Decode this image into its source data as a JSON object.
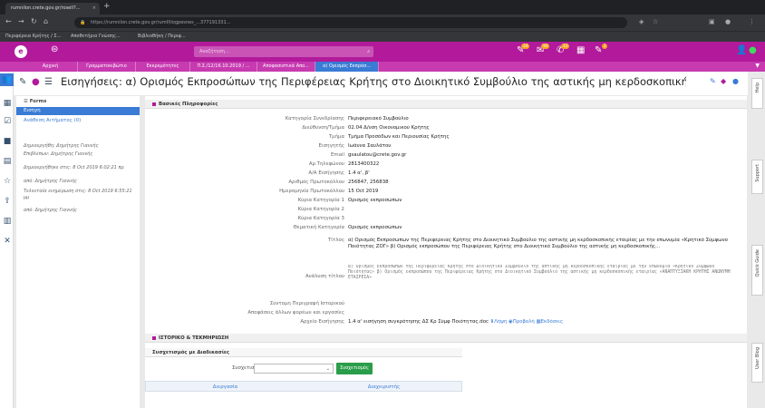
{
  "browser": {
    "tab_title": "rumnilon.crete.gov.gr/rosell?...",
    "url": "https://rumnilon.crete.gov.gr/rumf/ilogpesnes_...377191331...",
    "bookmarks": [
      "Περιφέρεια Κρήτης / Σ...",
      "Αποθετήριο Γνώσης...",
      "Βιβλιοθήκη / Περιφ..."
    ]
  },
  "app": {
    "logo": "e",
    "search_placeholder": "Αναζήτηση...",
    "badges": [
      "24",
      "93",
      "12",
      "1"
    ]
  },
  "module_tabs": [
    "Αρχική",
    "Γραμματοκιβώτιο",
    "Εκκρεμότητες",
    "Π.Σ./12/16.10.2019 / ...",
    "Αποφασιστικά Απο...",
    "α) Ορισμός Εκπρόσ..."
  ],
  "title": "Εισηγήσεις: α) Ορισμός Εκπροσώπων της Περιφέρειας Κρήτης στο Διοικητικό Συμβούλιο της αστικής μη κερδοσκοπικής εταιρίας με την επωνυ...",
  "side_tabs": [
    "Help",
    "Support",
    "Quick Guide",
    "User Blog"
  ],
  "left_panel": {
    "forms_label": "Forms",
    "selected": "Εισηγη",
    "assign_link": "Ανάθεση Αιτήματος (0)",
    "meta": [
      "Δημιουργήθη: Δημήτρης Γιαννής",
      "Επιβλέπων: Δημήτρης Γιαννής",
      "Δημιουργήθηκε στις: 8 Oct 2019 6:02:21 πμ",
      "από: Δημήτρης Γιαννής",
      "Τελευταία ενημέρωση στις: 8 Oct 2019 6:55:21 μμ",
      "από: Δημήτρης Γιαννής"
    ]
  },
  "main": {
    "section1": "Βασικές Πληροφορίες",
    "fields": [
      {
        "label": "Κατηγορία Συνεδρίασης",
        "value": "Περιφερειακό Συμβούλιο"
      },
      {
        "label": "Διεύθυνση/Τμήμα",
        "value": "02.04 Δ/νση Οικονομικού Κρήτης"
      },
      {
        "label": "Τμήμα",
        "value": "Τμήμα Προσόδων και Περιουσίας Κρήτης"
      },
      {
        "label": "Εισηγητής",
        "value": "Ιωάννα Σαυλάτου"
      },
      {
        "label": "Email",
        "value": "gsaulatou@crete.gov.gr"
      },
      {
        "label": "Αρ.Τηλεφώνου",
        "value": "2813400322"
      },
      {
        "label": "Α/Α Εισήγησης",
        "value": "1.4 α', β'"
      },
      {
        "label": "Αριθμός Πρωτοκόλλου",
        "value": "256847, 256838"
      },
      {
        "label": "Ημερομηνία Πρωτοκόλλου",
        "value": "15 Oct 2019"
      },
      {
        "label": "Κύρια Κατηγορία 1",
        "value": "Ορισμός εκπροσώπων"
      },
      {
        "label": "Κύρια Κατηγορία 2",
        "value": ""
      },
      {
        "label": "Κύρια Κατηγορία 3",
        "value": ""
      },
      {
        "label": "Θεματική Κατηγορία",
        "value": "Ορισμός εκπροσώπων"
      }
    ],
    "titlos_label": "Τίτλος",
    "titlos_value": "α) Ορισμός Εκπροσώπων της Περιφέρειας Κρήτης στο Διοικητικό Συμβούλιο της αστικής μη κερδοσκοπικής εταιρίας με την επωνυμία «Κρητικό Σύμφωνο Ποιότητας ΖΟΓ» β) Ορισμός εκπροσώπου της Περιφέρειας Κρήτης στο Διοικητικό Συμβούλιο της αστικής μη κερδοσκοπικής...",
    "analysis_label": "Ανάλυση τίτλου",
    "analysis_value": "α) Ορισμός Εκπροσώπων της Περιφέρειας Κρήτης στο Διοικητικό Συμβούλιο της αστικής μη κερδοσκοπικής εταιρίας με την επωνυμία «Κρητικό Σύμφωνο Ποιότητας» β) Ορισμός εκπροσώπου της Περιφέρειας Κρήτης στο Διοικητικό Συμβούλιο της αστικής μη κερδοσκοπικής εταιρίας «ΑΝΑΠΤΥΞΙΑΚΗ ΚΡΗΤΗΣ ΑΝΩΝΥΜΗ ΕΤΑΙΡΕΙΑ»",
    "extra_labels": [
      "Σύντομη Περιγραφή Ιστορικού",
      "Αποφάσεις άλλων φορέων και εργασίες"
    ],
    "file_label": "Αρχείο Εισήγησης",
    "file_value": "1.4 α' εισήγηση συγκρότησης ΔΣ Κρ Σύμφ Ποιότητας.doc",
    "file_actions": [
      "Λήψη",
      "Προβολή",
      "Εκδόσεις"
    ],
    "section2": "ΙΣΤΟΡΙΚΟ & ΤΕΚΜΗΡΙΩΣΗ",
    "workflow_head": "Συσχετισμός με Διαδικασίες",
    "workflow_label": "Συσχετισμός",
    "workflow_button": "Συσχετισμός",
    "workflow_cols": [
      "Διεργασία",
      "Διαχειριστής"
    ]
  }
}
